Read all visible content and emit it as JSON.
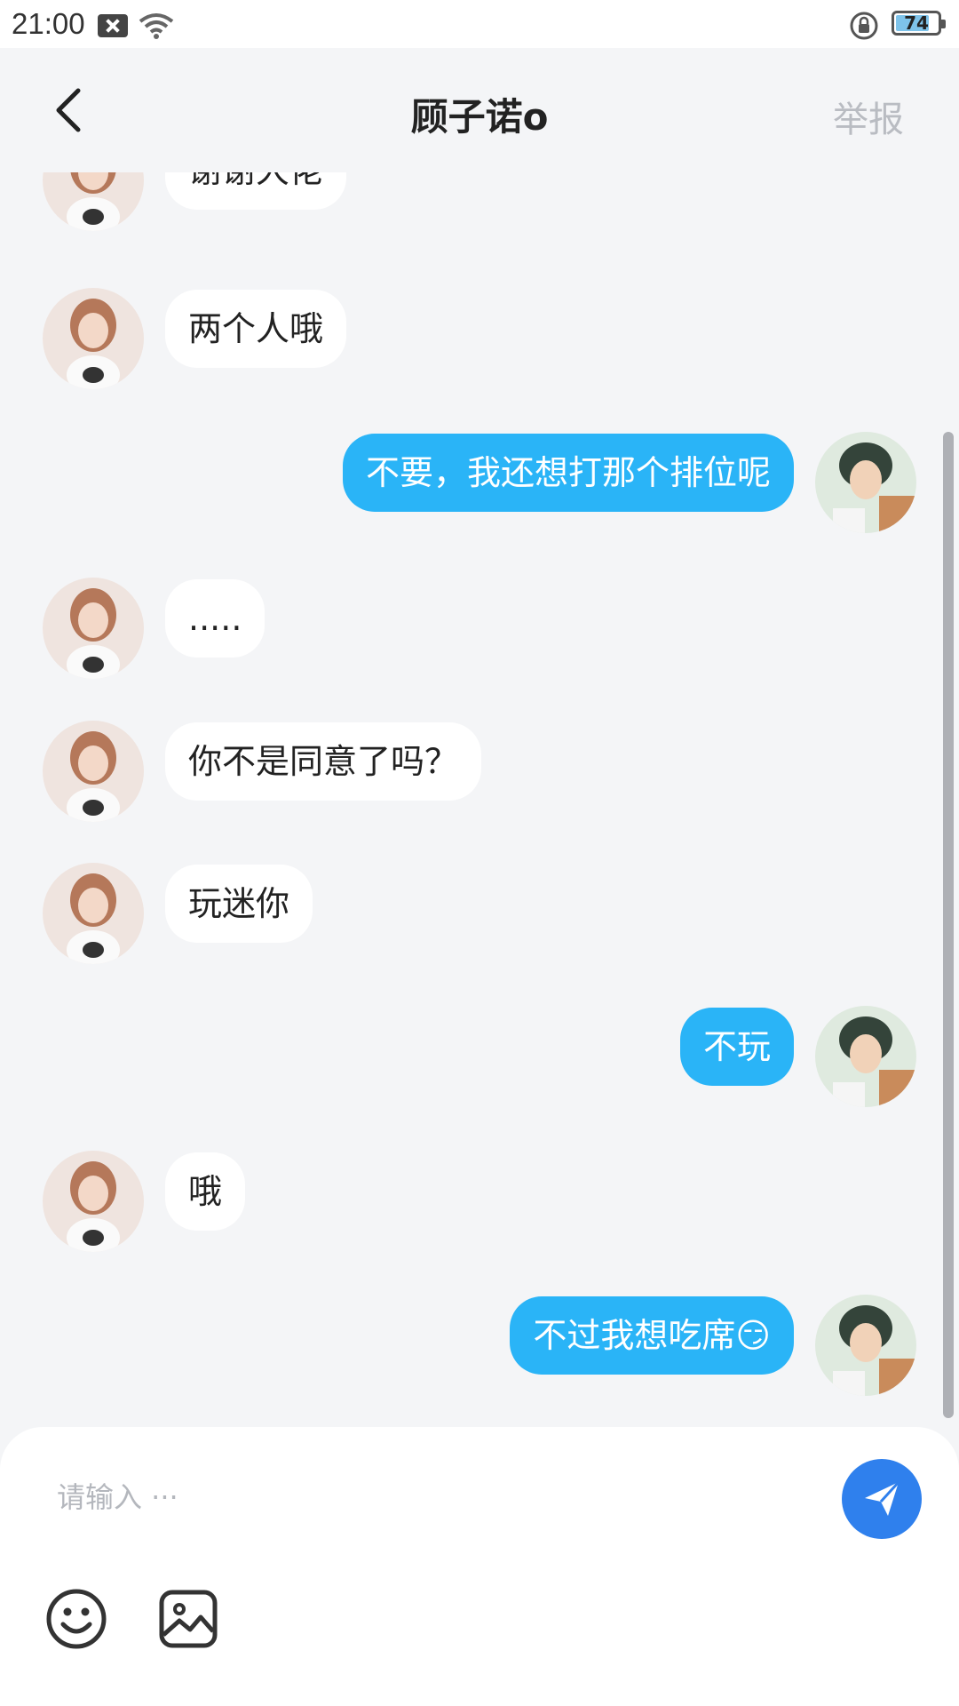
{
  "status_bar": {
    "time": "21:00",
    "battery": "74"
  },
  "header": {
    "title": "顾子诺o",
    "report_label": "举报"
  },
  "messages": [
    {
      "side": "left",
      "text": "谢谢大佬"
    },
    {
      "side": "left",
      "text": "两个人哦"
    },
    {
      "side": "right",
      "text": "不要，我还想打那个排位呢"
    },
    {
      "side": "left",
      "text": "....."
    },
    {
      "side": "left",
      "text": "你不是同意了吗？"
    },
    {
      "side": "left",
      "text": "玩迷你"
    },
    {
      "side": "right",
      "text": "不玩"
    },
    {
      "side": "left",
      "text": "哦"
    },
    {
      "side": "right",
      "text": "不过我想吃席😏"
    }
  ],
  "composer": {
    "placeholder": "请输入 ···"
  },
  "colors": {
    "accent_bubble": "#2ab4f7",
    "send_button": "#2f80ed",
    "background": "#f4f5f7"
  },
  "icons": {
    "back": "back-arrow-icon",
    "send": "paper-plane-icon",
    "emoji": "smiley-icon",
    "image": "image-icon"
  }
}
